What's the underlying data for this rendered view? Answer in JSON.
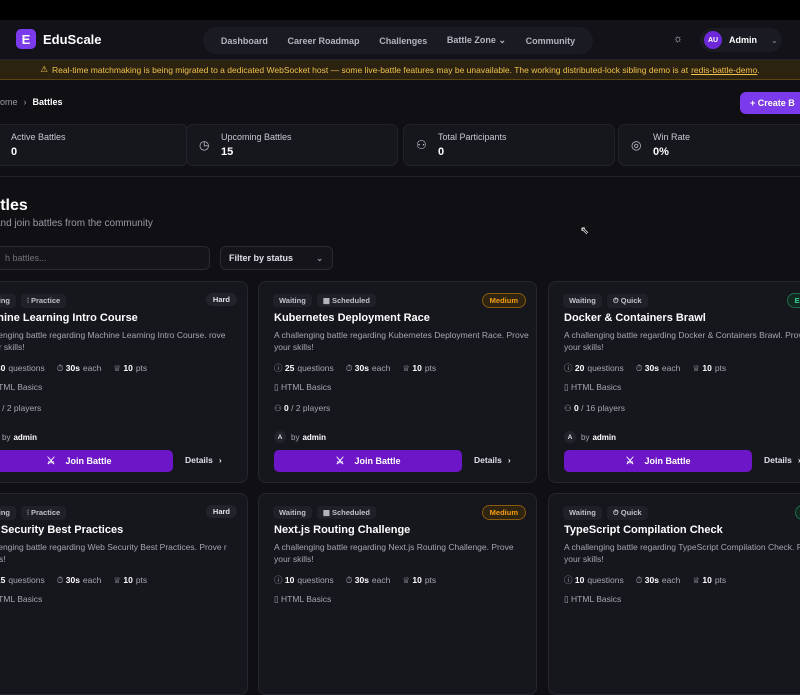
{
  "app": {
    "logo_letter": "E",
    "name": "EduScale"
  },
  "nav": {
    "links": [
      "Dashboard",
      "Career Roadmap",
      "Challenges",
      "Battle Zone",
      "Community"
    ],
    "battle_zone_chevron": "⌄",
    "theme_icon": "sun-icon",
    "user_initials": "AU",
    "user_name": "Admin"
  },
  "banner": {
    "text": "Real-time matchmaking is being migrated to a dedicated WebSocket host — some live-battle features may be unavailable. The working distributed-lock sibling demo is at",
    "link": "redis-battle-demo",
    "tail": ".",
    "color": "#f0c24a"
  },
  "breadcrumb": {
    "home": "ome",
    "current": "Battles"
  },
  "create_button": "Create B",
  "stats": [
    {
      "label": "Active Battles",
      "value": "0",
      "icon": "swords-icon"
    },
    {
      "label": "Upcoming Battles",
      "value": "15",
      "icon": "clock-icon"
    },
    {
      "label": "Total Participants",
      "value": "0",
      "icon": "users-icon"
    },
    {
      "label": "Win Rate",
      "value": "0%",
      "icon": "target-icon"
    }
  ],
  "page": {
    "title": "attles",
    "subtitle": "and join battles from the community"
  },
  "search": {
    "placeholder": "h battles..."
  },
  "filter": {
    "label": "Filter by status"
  },
  "cards": [
    {
      "status": "aiting",
      "mode": "Practice",
      "difficulty": "Hard",
      "title": "achine Learning Intro Course",
      "desc": "hallenging battle regarding Machine Learning Intro Course. rove your skills!",
      "questions": "30",
      "time": "30s",
      "points": "10",
      "category": "HTML Basics",
      "players_current": "0",
      "players_max": "/ 2 players",
      "author": "admin"
    },
    {
      "status": "Waiting",
      "mode": "Scheduled",
      "difficulty": "Medium",
      "title": "Kubernetes Deployment Race",
      "desc": "A challenging battle regarding Kubernetes Deployment Race. Prove your skills!",
      "questions": "25",
      "time": "30s",
      "points": "10",
      "category": "HTML Basics",
      "players_current": "0",
      "players_max": "/ 2 players",
      "author": "admin"
    },
    {
      "status": "Waiting",
      "mode": "Quick",
      "difficulty": "Eas",
      "title": "Docker & Containers Brawl",
      "desc": "A challenging battle regarding Docker & Containers Brawl. Prove your skills!",
      "questions": "20",
      "time": "30s",
      "points": "10",
      "category": "HTML Basics",
      "players_current": "0",
      "players_max": "/ 16 players",
      "author": "admin"
    },
    {
      "status": "aiting",
      "mode": "Practice",
      "difficulty": "Hard",
      "title": "eb Security Best Practices",
      "desc": "hallenging battle regarding Web Security Best Practices. Prove r skills!",
      "questions": "15",
      "time": "30s",
      "points": "10",
      "category": "HTML Basics"
    },
    {
      "status": "Waiting",
      "mode": "Scheduled",
      "difficulty": "Medium",
      "title": "Next.js Routing Challenge",
      "desc": "A challenging battle regarding Next.js Routing Challenge. Prove your skills!",
      "questions": "10",
      "time": "30s",
      "points": "10",
      "category": "HTML Basics"
    },
    {
      "status": "Waiting",
      "mode": "Quick",
      "difficulty": "E",
      "title": "TypeScript Compilation Check",
      "desc": "A challenging battle regarding TypeScript Compilation Check. Prove your skills!",
      "questions": "10",
      "time": "30s",
      "points": "10",
      "category": "HTML Basics"
    }
  ],
  "labels": {
    "questions": "questions",
    "each": "each",
    "pts": "pts",
    "by": "by",
    "join": "Join Battle",
    "details": "Details"
  },
  "colors": {
    "accent": "#7c3aed",
    "join": "#6d16c8",
    "medium": "#f59e0b",
    "easy": "#34d399"
  }
}
